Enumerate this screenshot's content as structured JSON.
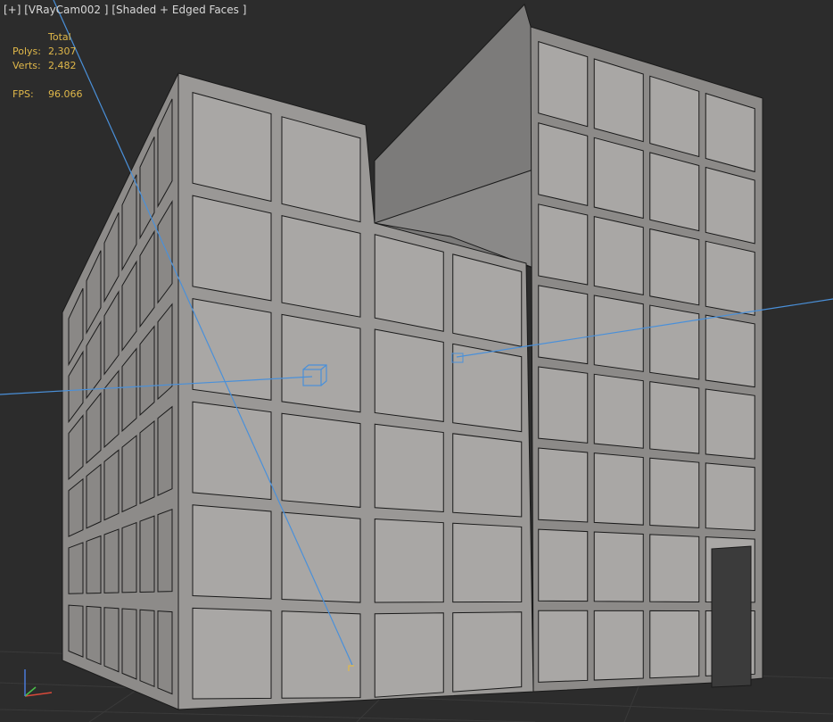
{
  "viewport": {
    "label_parts": [
      "[+]",
      "[VRayCam002 ]",
      "[Shaded + Edged Faces ]"
    ],
    "background": "#2c2c2c"
  },
  "stats": {
    "header": "Total",
    "polys_label": "Polys:",
    "polys_value": "2,307",
    "verts_label": "Verts:",
    "verts_value": "2,482",
    "fps_label": "FPS:",
    "fps_value": "96.066"
  },
  "colors": {
    "stats_text": "#e0b84a",
    "camera_line": "#4a90d9",
    "grid": "#3a3a3a",
    "facade_face": "#a9a7a5",
    "facade_frame": "#8a8886",
    "edge": "#1a1a1a"
  },
  "axis_gizmo": {
    "x": "x-axis",
    "y": "y-axis",
    "z": "z-axis"
  }
}
